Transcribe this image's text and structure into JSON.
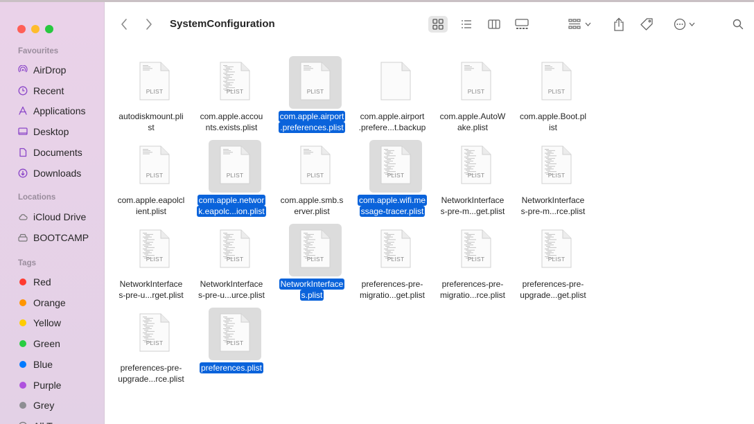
{
  "window": {
    "title": "SystemConfiguration"
  },
  "sidebar": {
    "favourites_title": "Favourites",
    "favourites": [
      {
        "label": "AirDrop",
        "icon": "airdrop-icon"
      },
      {
        "label": "Recent",
        "icon": "clock-icon"
      },
      {
        "label": "Applications",
        "icon": "applications-icon"
      },
      {
        "label": "Desktop",
        "icon": "desktop-icon"
      },
      {
        "label": "Documents",
        "icon": "document-icon"
      },
      {
        "label": "Downloads",
        "icon": "download-icon"
      }
    ],
    "locations_title": "Locations",
    "locations": [
      {
        "label": "iCloud Drive",
        "icon": "cloud-icon"
      },
      {
        "label": "BOOTCAMP",
        "icon": "drive-icon"
      }
    ],
    "tags_title": "Tags",
    "tags": [
      {
        "label": "Red",
        "color": "#ff3b30"
      },
      {
        "label": "Orange",
        "color": "#ff9500"
      },
      {
        "label": "Yellow",
        "color": "#ffcc00"
      },
      {
        "label": "Green",
        "color": "#28cd41"
      },
      {
        "label": "Blue",
        "color": "#007aff"
      },
      {
        "label": "Purple",
        "color": "#af52de"
      },
      {
        "label": "Grey",
        "color": "#8e8e93"
      },
      {
        "label": "All Tags",
        "color": ""
      }
    ]
  },
  "files": [
    {
      "line1": "autodiskmount.pli",
      "line2": "st",
      "label": "PLIST",
      "selected": false,
      "detail": "light"
    },
    {
      "line1": "com.apple.accou",
      "line2": "nts.exists.plist",
      "label": "PLIST",
      "selected": false,
      "detail": "heavy"
    },
    {
      "line1": "com.apple.airport",
      "line2": ".preferences.plist",
      "label": "PLIST",
      "selected": true,
      "detail": "light"
    },
    {
      "line1": "com.apple.airport",
      "line2": ".prefere...t.backup",
      "label": "",
      "selected": false,
      "detail": "none"
    },
    {
      "line1": "com.apple.AutoW",
      "line2": "ake.plist",
      "label": "PLIST",
      "selected": false,
      "detail": "light"
    },
    {
      "line1": "com.apple.Boot.pl",
      "line2": "ist",
      "label": "PLIST",
      "selected": false,
      "detail": "light"
    },
    {
      "line1": "com.apple.eapolcl",
      "line2": "ient.plist",
      "label": "PLIST",
      "selected": false,
      "detail": "light"
    },
    {
      "line1": "com.apple.networ",
      "line2": "k.eapolc...ion.plist",
      "label": "PLIST",
      "selected": true,
      "detail": "light"
    },
    {
      "line1": "com.apple.smb.s",
      "line2": "erver.plist",
      "label": "PLIST",
      "selected": false,
      "detail": "light"
    },
    {
      "line1": "com.apple.wifi.me",
      "line2": "ssage-tracer.plist",
      "label": "PLIST",
      "selected": true,
      "detail": "heavy"
    },
    {
      "line1": "NetworkInterface",
      "line2": "s-pre-m...get.plist",
      "label": "PLIST",
      "selected": false,
      "detail": "heavy"
    },
    {
      "line1": "NetworkInterface",
      "line2": "s-pre-m...rce.plist",
      "label": "PLIST",
      "selected": false,
      "detail": "heavy"
    },
    {
      "line1": "NetworkInterface",
      "line2": "s-pre-u...rget.plist",
      "label": "PLIST",
      "selected": false,
      "detail": "heavy"
    },
    {
      "line1": "NetworkInterface",
      "line2": "s-pre-u...urce.plist",
      "label": "PLIST",
      "selected": false,
      "detail": "heavy"
    },
    {
      "line1": "NetworkInterface",
      "line2": "s.plist",
      "label": "PLIST",
      "selected": true,
      "detail": "heavy"
    },
    {
      "line1": "preferences-pre-",
      "line2": "migratio...get.plist",
      "label": "PLIST",
      "selected": false,
      "detail": "heavy"
    },
    {
      "line1": "preferences-pre-",
      "line2": "migratio...rce.plist",
      "label": "PLIST",
      "selected": false,
      "detail": "heavy"
    },
    {
      "line1": "preferences-pre-",
      "line2": "upgrade...get.plist",
      "label": "PLIST",
      "selected": false,
      "detail": "heavy"
    },
    {
      "line1": "preferences-pre-",
      "line2": "upgrade...rce.plist",
      "label": "PLIST",
      "selected": false,
      "detail": "heavy"
    },
    {
      "line1": "preferences.plist",
      "line2": "",
      "label": "PLIST",
      "selected": true,
      "detail": "heavy"
    }
  ]
}
